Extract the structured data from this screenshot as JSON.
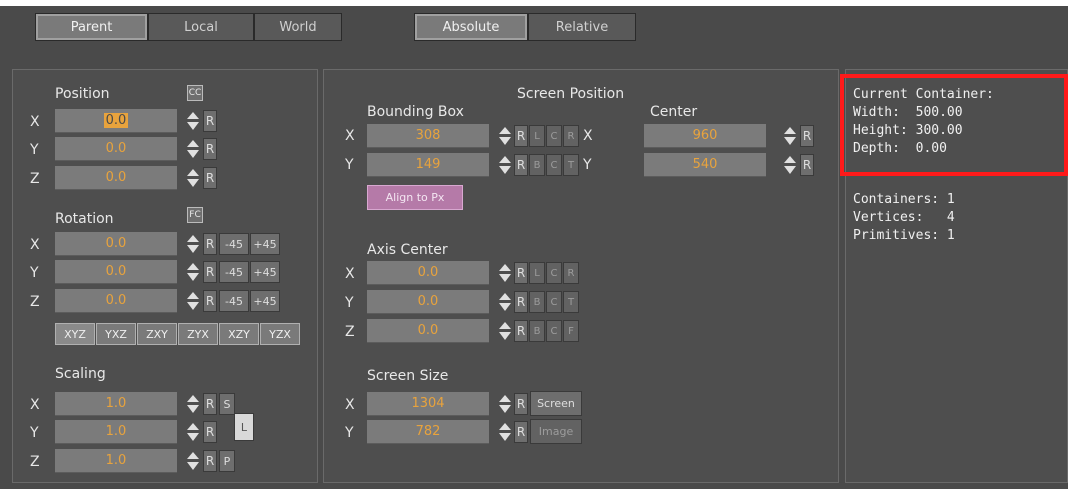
{
  "tabs_space": [
    "Parent",
    "Local",
    "World"
  ],
  "tabs_mode": [
    "Absolute",
    "Relative"
  ],
  "left": {
    "position": {
      "title": "Position",
      "cc": "CC",
      "rows": [
        {
          "axis": "X",
          "value": "0.0"
        },
        {
          "axis": "Y",
          "value": "0.0"
        },
        {
          "axis": "Z",
          "value": "0.0"
        }
      ]
    },
    "rotation": {
      "title": "Rotation",
      "fc": "FC",
      "rows": [
        {
          "axis": "X",
          "value": "0.0"
        },
        {
          "axis": "Y",
          "value": "0.0"
        },
        {
          "axis": "Z",
          "value": "0.0"
        }
      ],
      "minus": "-45",
      "plus": "+45",
      "orders": [
        "XYZ",
        "YXZ",
        "ZXY",
        "ZYX",
        "XZY",
        "YZX"
      ]
    },
    "scaling": {
      "title": "Scaling",
      "rows": [
        {
          "axis": "X",
          "value": "1.0",
          "btn": "S"
        },
        {
          "axis": "Y",
          "value": "1.0",
          "btn": "L"
        },
        {
          "axis": "Z",
          "value": "1.0",
          "btn": "P"
        }
      ]
    }
  },
  "middle": {
    "screen_position": "Screen Position",
    "bounding_box": {
      "title": "Bounding Box",
      "rows": [
        {
          "axis": "X",
          "value": "308",
          "btns": [
            "L",
            "C",
            "R"
          ]
        },
        {
          "axis": "Y",
          "value": "149",
          "btns": [
            "B",
            "C",
            "T"
          ]
        }
      ]
    },
    "center": {
      "title": "Center",
      "rows": [
        {
          "axis": "X",
          "value": "960"
        },
        {
          "axis": "Y",
          "value": "540"
        }
      ]
    },
    "align_label": "Align to Px",
    "axis_center": {
      "title": "Axis Center",
      "rows": [
        {
          "axis": "X",
          "value": "0.0",
          "btns": [
            "L",
            "C",
            "R"
          ]
        },
        {
          "axis": "Y",
          "value": "0.0",
          "btns": [
            "B",
            "C",
            "T"
          ]
        },
        {
          "axis": "Z",
          "value": "0.0",
          "btns": [
            "B",
            "C",
            "F"
          ]
        }
      ]
    },
    "screen_size": {
      "title": "Screen Size",
      "rows": [
        {
          "axis": "X",
          "value": "1304",
          "btn": "Screen"
        },
        {
          "axis": "Y",
          "value": "782",
          "btn": "Image"
        }
      ]
    }
  },
  "reset_label": "R",
  "info": {
    "lines_box": [
      "Current Container:",
      "Width:  500.00",
      "Height: 300.00",
      "Depth:  0.00"
    ],
    "lines_stats": [
      "Containers: 1",
      "Vertices:   4",
      "Primitives: 1"
    ]
  },
  "colors": {
    "value_text": "#e8a33d",
    "highlight": "#ff1a1a",
    "align_button": "#b57aa8"
  }
}
